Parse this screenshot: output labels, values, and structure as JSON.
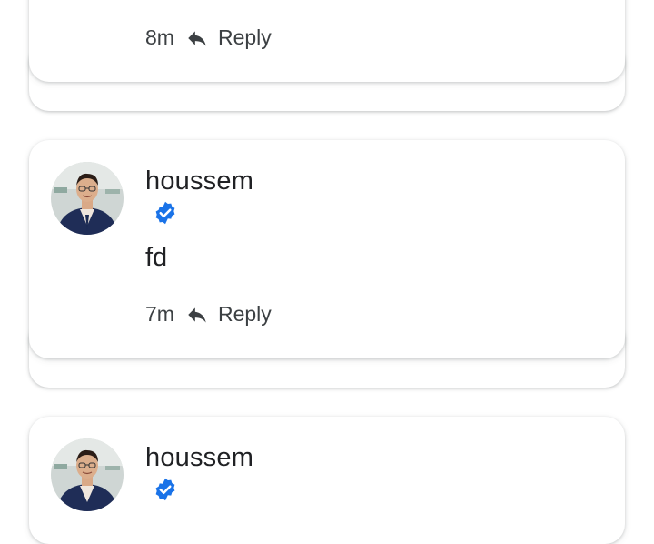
{
  "comments": [
    {
      "username": "",
      "text": "",
      "time": "8m",
      "reply_label": "Reply"
    },
    {
      "username": "houssem",
      "verified": true,
      "text": "fd",
      "time": "7m",
      "reply_label": "Reply"
    },
    {
      "username": "houssem",
      "verified": true,
      "text": "",
      "time": "",
      "reply_label": ""
    }
  ],
  "colors": {
    "verified_badge": "#1a73e8",
    "text_primary": "#202124",
    "text_secondary": "#3c4043",
    "card_background": "#ffffff"
  },
  "icons": {
    "reply": "reply-icon",
    "verified": "verified-badge-icon",
    "avatar": "user-avatar"
  }
}
